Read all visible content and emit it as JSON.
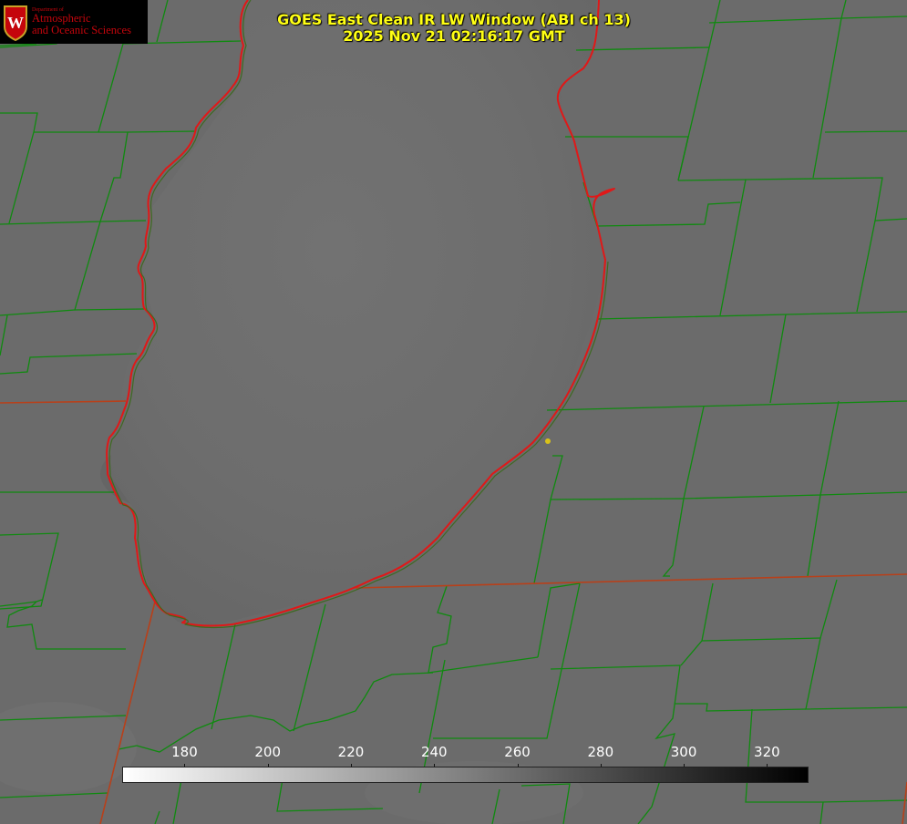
{
  "header": {
    "title_line1": "GOES East Clean IR LW Window (ABI ch 13)",
    "title_line2": "2025 Nov 21 02:16:17 GMT"
  },
  "logo": {
    "department": "Department of",
    "name_line1": "Atmospheric",
    "name_line2": "and Oceanic Sciences",
    "seal_letter": "W",
    "colors": {
      "background": "#000000",
      "text": "#c5050c",
      "seal_gold": "#c9a227"
    }
  },
  "colorbar": {
    "ticks": [
      "180",
      "200",
      "220",
      "240",
      "260",
      "280",
      "300",
      "320"
    ],
    "range": [
      165,
      330
    ],
    "gradient": [
      "#ffffff",
      "#000000"
    ]
  },
  "map": {
    "background_color": "#6b6b6b",
    "county_line_color": "#0f8a0f",
    "state_line_color": "#b8401a",
    "coastline_color": "#e01818",
    "marker_color": "#d9c21a",
    "features": [
      "county boundaries",
      "state boundaries",
      "lake coastline",
      "point marker"
    ]
  }
}
